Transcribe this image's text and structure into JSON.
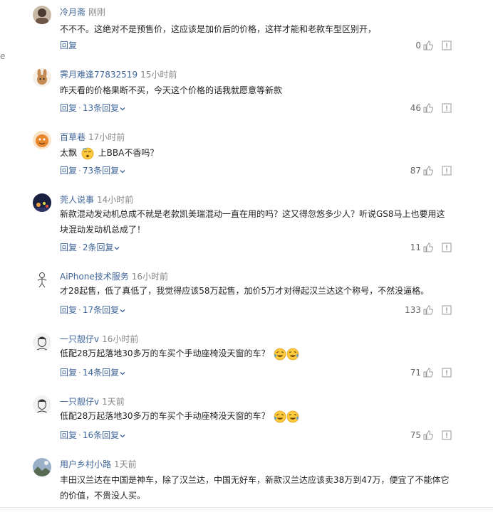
{
  "edge": {
    "left_letter": "e"
  },
  "colors": {
    "username": "#406599",
    "meta": "#888888",
    "text": "#222222"
  },
  "labels": {
    "reply": "回复",
    "sep": "·"
  },
  "comments": [
    {
      "user": "冷月斋",
      "time": "刚刚",
      "text": "不不不。这绝对不是预售价，这应该是加价后的价格，这样才能和老款车型区别开，",
      "more": "",
      "likes": "0",
      "avatar_icon": "person-head-icon"
    },
    {
      "user": "霁月难逢77832519",
      "time": "15小时前",
      "text": "昨天看的价格果断不买，今天这个价格的话我就愿意等新款",
      "more": "13条回复",
      "likes": "46",
      "avatar_icon": "rabbit-icon"
    },
    {
      "user": "百草巷",
      "time": "17小时前",
      "text_before": "太飘",
      "text_after": "上BBA不香吗？",
      "more": "73条回复",
      "likes": "87",
      "avatar_icon": "orange-creature-icon"
    },
    {
      "user": "莞人说事",
      "time": "14小时前",
      "text": "新款混动发动机总成不就是老款凯美瑞混动一直在用的吗？这又得忽悠多少人？听说GS8马上也要用这块混动发动机总成了！",
      "more": "2条回复",
      "likes": "11",
      "avatar_icon": "night-scene-icon"
    },
    {
      "user": "AiPhone技术服务",
      "time": "16小时前",
      "text": "才28起售，低了真低了，我觉得应该58万起售，加价5万才对得起汉兰达这个称号，不然没逼格。",
      "more": "17条回复",
      "likes": "133",
      "avatar_icon": "figure-sketch-icon"
    },
    {
      "user": "一只靓仔v",
      "time": "16小时前",
      "text": "低配28万起落地30多万的车买个手动座椅没天窗的车？",
      "more": "14条回复",
      "likes": "71",
      "avatar_icon": "sketch-face-icon"
    },
    {
      "user": "一只靓仔v",
      "time": "1天前",
      "text": "低配28万起落地30多万的车买个手动座椅没天窗的车？",
      "more": "16条回复",
      "likes": "75",
      "avatar_icon": "sketch-face-icon"
    },
    {
      "user": "用户乡村小路",
      "time": "1天前",
      "text": "丰田汉兰达在中国是神车，除了汉兰达，中国无好车，新款汉兰达应该卖38万到47万，便宜了不能体它的价值，不贵没人买。",
      "more": "",
      "likes": "",
      "avatar_icon": "landscape-icon"
    }
  ]
}
